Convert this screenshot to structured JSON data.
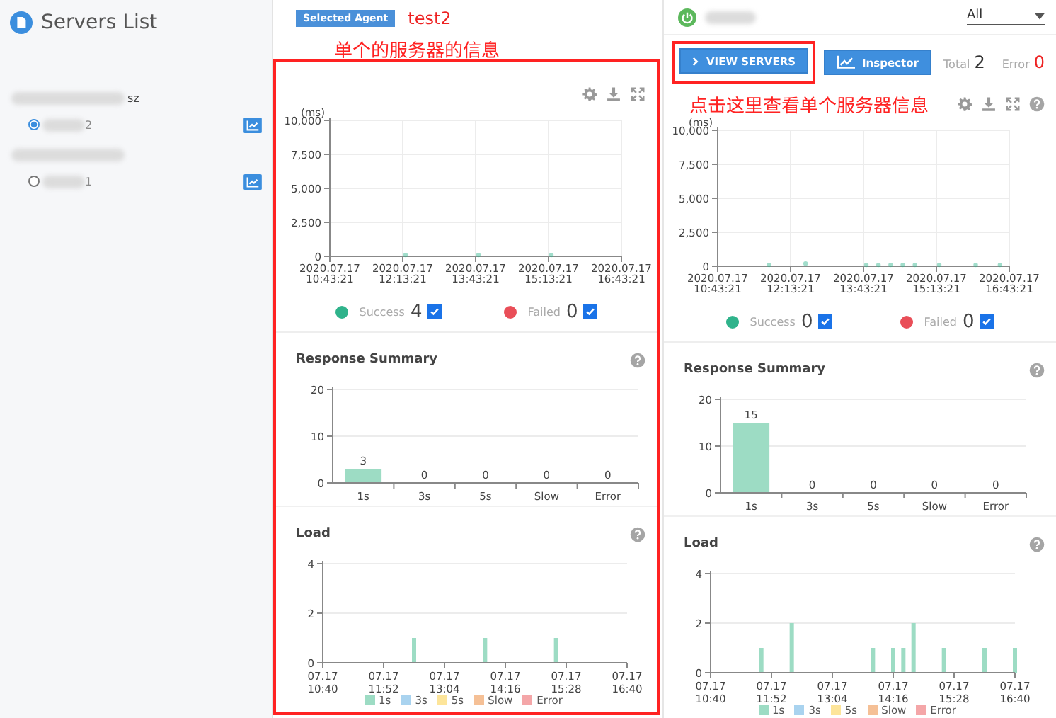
{
  "sidebar": {
    "title": "Servers List",
    "groups": [
      {
        "label": "sz",
        "servers": [
          {
            "name": "2",
            "selected": true
          }
        ]
      },
      {
        "servers": [
          {
            "name": "1",
            "selected": false
          }
        ]
      }
    ]
  },
  "panels": [
    {
      "kind": "agent",
      "badge": "Selected Agent",
      "agent": "test2",
      "annotation": "单个的服务器的信息",
      "scatter": {
        "chart_data": {
          "type": "scatter",
          "grid": true,
          "ylabel": "(ms)",
          "ylim": [
            0,
            10000
          ],
          "yticks": [
            {
              "value": 0,
              "label": "0"
            },
            {
              "value": 2500,
              "label": "2,500"
            },
            {
              "value": 5000,
              "label": "5,000"
            },
            {
              "value": 7500,
              "label": "7,500"
            },
            {
              "value": 10000,
              "label": "10,000"
            }
          ],
          "categories": [
            "2020.07.17 10:43:21",
            null,
            null,
            null,
            null,
            null,
            "2020.07.17 12:13:21",
            null,
            null,
            null,
            null,
            null,
            "2020.07.17 13:43:21",
            null,
            null,
            null,
            null,
            null,
            "2020.07.17 15:13:21",
            null,
            null,
            null,
            null,
            null,
            "2020.07.17 16:43:21"
          ],
          "series": [
            {
              "name": "Success",
              "color": "#2fb38b",
              "values": [
                null,
                null,
                null,
                null,
                null,
                null,
                100,
                null,
                null,
                null,
                null,
                null,
                100,
                null,
                null,
                null,
                null,
                null,
                100,
                null,
                null,
                null,
                null,
                null,
                null
              ]
            },
            {
              "name": "Failed",
              "color": "#e94e58",
              "values": [
                null,
                null,
                null,
                null,
                null,
                null,
                null,
                null,
                null,
                null,
                null,
                null,
                null,
                null,
                null,
                null,
                null,
                null,
                null,
                null,
                null,
                null,
                null,
                null,
                null
              ]
            }
          ]
        },
        "legend": [
          {
            "count": "4",
            "checked": true
          },
          {
            "count": "0",
            "checked": true
          }
        ]
      },
      "summary": {
        "title": "Response Summary",
        "chart_data": {
          "type": "bar",
          "grid": true,
          "categories": [
            "1s",
            "3s",
            "5s",
            "Slow",
            "Error"
          ],
          "ylim": [
            0,
            20
          ],
          "yticks": [
            0,
            10,
            20
          ],
          "data_labels": true,
          "series": [
            {
              "color": "#9ddcc4",
              "values": [
                3,
                0,
                0,
                0,
                0
              ]
            }
          ]
        }
      },
      "load": {
        "title": "Load",
        "chart_data": {
          "type": "bar",
          "grid": true,
          "stacked": true,
          "ylim": [
            0,
            4
          ],
          "yticks": [
            0,
            2,
            4
          ],
          "categories": [
            "07.17 10:40",
            null,
            null,
            null,
            null,
            null,
            "07.17 11:52",
            null,
            null,
            null,
            null,
            null,
            "07.17 13:04",
            null,
            null,
            null,
            null,
            null,
            "07.17 14:16",
            null,
            null,
            null,
            null,
            null,
            "07.17 15:28",
            null,
            null,
            null,
            null,
            null,
            "07.17 16:40"
          ],
          "series": [
            {
              "name": "1s",
              "color": "#9ddcc4",
              "values": [
                0,
                0,
                0,
                0,
                0,
                0,
                0,
                0,
                0,
                1,
                0,
                0,
                0,
                0,
                0,
                0,
                1,
                0,
                0,
                0,
                0,
                0,
                0,
                1,
                0,
                0,
                0,
                0,
                0,
                0,
                0
              ]
            },
            {
              "name": "3s",
              "color": "#a9d3ef",
              "values": [
                0,
                0,
                0,
                0,
                0,
                0,
                0,
                0,
                0,
                0,
                0,
                0,
                0,
                0,
                0,
                0,
                0,
                0,
                0,
                0,
                0,
                0,
                0,
                0,
                0,
                0,
                0,
                0,
                0,
                0,
                0
              ]
            },
            {
              "name": "5s",
              "color": "#fde59a",
              "values": [
                0,
                0,
                0,
                0,
                0,
                0,
                0,
                0,
                0,
                0,
                0,
                0,
                0,
                0,
                0,
                0,
                0,
                0,
                0,
                0,
                0,
                0,
                0,
                0,
                0,
                0,
                0,
                0,
                0,
                0,
                0
              ]
            },
            {
              "name": "Slow",
              "color": "#f5c096",
              "values": [
                0,
                0,
                0,
                0,
                0,
                0,
                0,
                0,
                0,
                0,
                0,
                0,
                0,
                0,
                0,
                0,
                0,
                0,
                0,
                0,
                0,
                0,
                0,
                0,
                0,
                0,
                0,
                0,
                0,
                0,
                0
              ]
            },
            {
              "name": "Error",
              "color": "#f4a6a8",
              "values": [
                0,
                0,
                0,
                0,
                0,
                0,
                0,
                0,
                0,
                0,
                0,
                0,
                0,
                0,
                0,
                0,
                0,
                0,
                0,
                0,
                0,
                0,
                0,
                0,
                0,
                0,
                0,
                0,
                0,
                0,
                0
              ]
            }
          ]
        }
      }
    },
    {
      "kind": "overview",
      "filter": {
        "value": "All"
      },
      "buttons": [
        {
          "label": "VIEW SERVERS",
          "kind": "chevron",
          "annotated": true
        },
        {
          "label": "Inspector",
          "kind": "chart",
          "annotated": false
        }
      ],
      "stats": [
        {
          "label": "Total",
          "value": "2",
          "kind": "total"
        },
        {
          "label": "Error",
          "value": "0",
          "kind": "error"
        }
      ],
      "annotation": "点击这里查看单个服务器信息",
      "scatter": {
        "chart_data": {
          "type": "scatter",
          "grid": true,
          "ylabel": "(ms)",
          "ylim": [
            0,
            10000
          ],
          "yticks": [
            {
              "value": 0,
              "label": "0"
            },
            {
              "value": 2500,
              "label": "2,500"
            },
            {
              "value": 5000,
              "label": "5,000"
            },
            {
              "value": 7500,
              "label": "7,500"
            },
            {
              "value": 10000,
              "label": "10,000"
            }
          ],
          "categories": [
            "2020.07.17 10:43:21",
            null,
            null,
            null,
            null,
            null,
            "2020.07.17 12:13:21",
            null,
            null,
            null,
            null,
            null,
            "2020.07.17 13:43:21",
            null,
            null,
            null,
            null,
            null,
            "2020.07.17 15:13:21",
            null,
            null,
            null,
            null,
            null,
            "2020.07.17 16:43:21"
          ],
          "series": [
            {
              "name": "Success",
              "color": "#2fb38b",
              "values": [
                null,
                null,
                null,
                null,
                100,
                null,
                null,
                200,
                null,
                null,
                null,
                null,
                100,
                100,
                100,
                100,
                100,
                null,
                100,
                null,
                null,
                100,
                null,
                100,
                null
              ]
            },
            {
              "name": "Failed",
              "color": "#e94e58",
              "values": [
                null,
                null,
                null,
                null,
                null,
                null,
                null,
                null,
                null,
                null,
                null,
                null,
                null,
                null,
                null,
                null,
                null,
                null,
                null,
                null,
                null,
                null,
                null,
                null,
                null
              ]
            }
          ]
        },
        "legend": [
          {
            "count": "0",
            "checked": true
          },
          {
            "count": "0",
            "checked": true
          }
        ]
      },
      "summary": {
        "title": "Response Summary",
        "chart_data": {
          "type": "bar",
          "grid": true,
          "categories": [
            "1s",
            "3s",
            "5s",
            "Slow",
            "Error"
          ],
          "ylim": [
            0,
            20
          ],
          "yticks": [
            0,
            10,
            20
          ],
          "data_labels": true,
          "series": [
            {
              "color": "#9ddcc4",
              "values": [
                15,
                0,
                0,
                0,
                0
              ]
            }
          ]
        }
      },
      "load": {
        "title": "Load",
        "chart_data": {
          "type": "bar",
          "grid": true,
          "stacked": true,
          "ylim": [
            0,
            4
          ],
          "yticks": [
            0,
            2,
            4
          ],
          "categories": [
            "07.17 10:40",
            null,
            null,
            null,
            null,
            null,
            "07.17 11:52",
            null,
            null,
            null,
            null,
            null,
            "07.17 13:04",
            null,
            null,
            null,
            null,
            null,
            "07.17 14:16",
            null,
            null,
            null,
            null,
            null,
            "07.17 15:28",
            null,
            null,
            null,
            null,
            null,
            "07.17 16:40"
          ],
          "series": [
            {
              "name": "1s",
              "color": "#9ddcc4",
              "values": [
                0,
                0,
                0,
                0,
                0,
                1,
                0,
                0,
                2,
                0,
                0,
                0,
                0,
                0,
                0,
                0,
                1,
                0,
                1,
                1,
                2,
                0,
                0,
                1,
                0,
                0,
                0,
                1,
                0,
                0,
                1
              ]
            },
            {
              "name": "3s",
              "color": "#a9d3ef",
              "values": [
                0,
                0,
                0,
                0,
                0,
                0,
                0,
                0,
                0,
                0,
                0,
                0,
                0,
                0,
                0,
                0,
                0,
                0,
                0,
                0,
                0,
                0,
                0,
                0,
                0,
                0,
                0,
                0,
                0,
                0,
                0
              ]
            },
            {
              "name": "5s",
              "color": "#fde59a",
              "values": [
                0,
                0,
                0,
                0,
                0,
                0,
                0,
                0,
                0,
                0,
                0,
                0,
                0,
                0,
                0,
                0,
                0,
                0,
                0,
                0,
                0,
                0,
                0,
                0,
                0,
                0,
                0,
                0,
                0,
                0,
                0
              ]
            },
            {
              "name": "Slow",
              "color": "#f5c096",
              "values": [
                0,
                0,
                0,
                0,
                0,
                0,
                0,
                0,
                0,
                0,
                0,
                0,
                0,
                0,
                0,
                0,
                0,
                0,
                0,
                0,
                0,
                0,
                0,
                0,
                0,
                0,
                0,
                0,
                0,
                0,
                0
              ]
            },
            {
              "name": "Error",
              "color": "#f4a6a8",
              "values": [
                0,
                0,
                0,
                0,
                0,
                0,
                0,
                0,
                0,
                0,
                0,
                0,
                0,
                0,
                0,
                0,
                0,
                0,
                0,
                0,
                0,
                0,
                0,
                0,
                0,
                0,
                0,
                0,
                0,
                0,
                0
              ]
            }
          ]
        }
      }
    }
  ]
}
